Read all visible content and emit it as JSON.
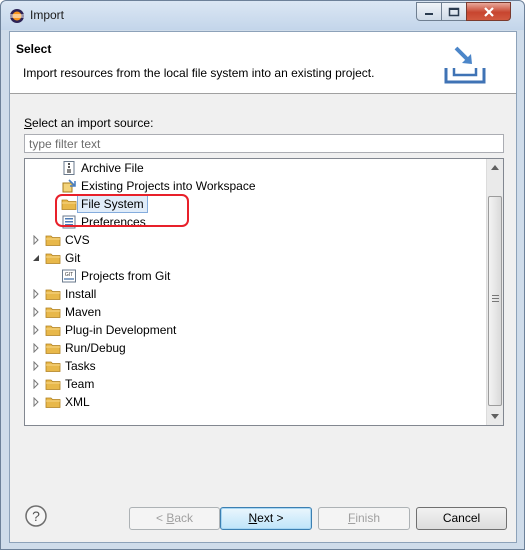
{
  "window": {
    "title": "Import"
  },
  "header": {
    "title": "Select",
    "description": "Import resources from the local file system into an existing project."
  },
  "select_label": {
    "mnemonic": "S",
    "rest": "elect an import source:"
  },
  "filter": {
    "placeholder": "type filter text",
    "value": ""
  },
  "tree": {
    "items": [
      {
        "label": "Archive File",
        "icon": "archive-file-icon",
        "level": 1
      },
      {
        "label": "Existing Projects into Workspace",
        "icon": "existing-projects-icon",
        "level": 1
      },
      {
        "label": "File System",
        "icon": "folder-icon",
        "level": 1,
        "selected": true
      },
      {
        "label": "Preferences",
        "icon": "preferences-icon",
        "level": 1
      },
      {
        "label": "CVS",
        "icon": "folder-icon",
        "level": 0,
        "expanded": false
      },
      {
        "label": "Git",
        "icon": "folder-icon",
        "level": 0,
        "expanded": true
      },
      {
        "label": "Projects from Git",
        "icon": "git-projects-icon",
        "level": 1
      },
      {
        "label": "Install",
        "icon": "folder-icon",
        "level": 0,
        "expanded": false
      },
      {
        "label": "Maven",
        "icon": "folder-icon",
        "level": 0,
        "expanded": false
      },
      {
        "label": "Plug-in Development",
        "icon": "folder-icon",
        "level": 0,
        "expanded": false
      },
      {
        "label": "Run/Debug",
        "icon": "folder-icon",
        "level": 0,
        "expanded": false
      },
      {
        "label": "Tasks",
        "icon": "folder-icon",
        "level": 0,
        "expanded": false
      },
      {
        "label": "Team",
        "icon": "folder-icon",
        "level": 0,
        "expanded": false
      },
      {
        "label": "XML",
        "icon": "folder-icon",
        "level": 0,
        "expanded": false
      }
    ]
  },
  "buttons": {
    "back": {
      "prefix": "< ",
      "mnemonic": "B",
      "rest": "ack",
      "enabled": false
    },
    "next": {
      "mnemonic": "N",
      "rest": "ext >",
      "enabled": true
    },
    "finish": {
      "mnemonic": "F",
      "rest": "inish",
      "enabled": false
    },
    "cancel": {
      "label": "Cancel",
      "enabled": true
    }
  },
  "colors": {
    "highlight_ring": "#e8202a",
    "selection": "#e0ecf9",
    "folder": "#e8b84a"
  }
}
